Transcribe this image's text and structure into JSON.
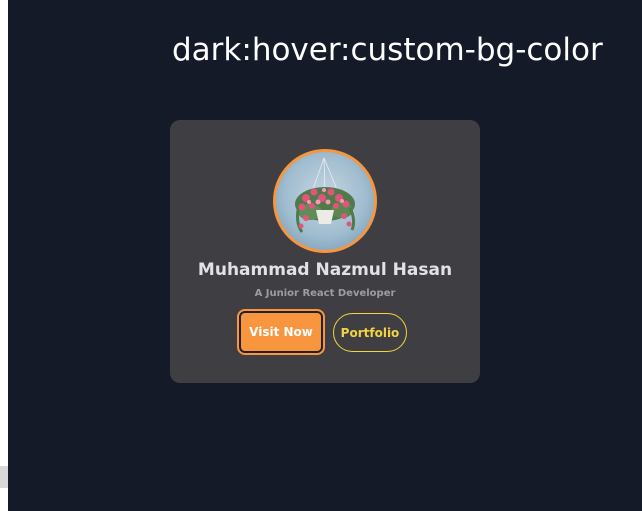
{
  "page": {
    "title": "dark:hover:custom-bg-color"
  },
  "profile_card": {
    "avatar_icon": "hanging-flower-basket-photo",
    "name": "Muhammad Nazmul Hasan",
    "role": "A Junior React Developer",
    "buttons": {
      "visit_label": "Visit Now",
      "portfolio_label": "Portfolio"
    }
  },
  "colors": {
    "background": "#141a28",
    "card": "#3f3f43",
    "accent_orange": "#f7963e",
    "accent_yellow": "#f2d341"
  }
}
